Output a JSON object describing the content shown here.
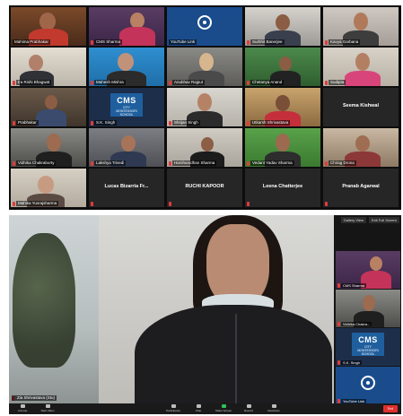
{
  "gallery": {
    "tiles": [
      {
        "name": "Mahima Prabhakar",
        "mic": false
      },
      {
        "name": "CMS Sharma",
        "mic": true
      },
      {
        "name": "YouTube Link",
        "mic": false
      },
      {
        "name": "Surbhit Banerjee",
        "mic": true
      },
      {
        "name": "Kavya Garbana",
        "mic": true
      },
      {
        "name": "Ira Rishi Bhagwat",
        "mic": true
      },
      {
        "name": "Mahesh Mishra",
        "mic": true
      },
      {
        "name": "Anubhav Rajput",
        "mic": true
      },
      {
        "name": "Chetanya Anand",
        "mic": true
      },
      {
        "name": "Sudipta",
        "mic": true
      },
      {
        "name": "Prabhakar",
        "mic": true
      },
      {
        "name": "S.K. Singh",
        "mic": true
      },
      {
        "name": "Shrijan Singh",
        "mic": true
      },
      {
        "name": "Utkarsh Shrivastava",
        "mic": true
      },
      {
        "name": "Seema Kishwal",
        "mic": false
      },
      {
        "name": "Vidhika Chakraborty",
        "mic": true
      },
      {
        "name": "Lakshya Trivedi",
        "mic": true
      },
      {
        "name": "Harshvardhan Sharma",
        "mic": true
      },
      {
        "name": "Vedant Yadav Sharma",
        "mic": true
      },
      {
        "name": "Chirag Drona",
        "mic": true
      },
      {
        "name": "Mahika Yuvrajsharma",
        "mic": true
      },
      {
        "name": "Lucas Bizarria Fr...",
        "mic": true
      },
      {
        "name": "RUCHI KAPOOR",
        "mic": true
      },
      {
        "name": "Leena Chatterjee",
        "mic": true
      },
      {
        "name": "Pranab Agarwal",
        "mic": true
      }
    ]
  },
  "speaker_view": {
    "speaker_name": "Zia Shrivastava (Stu)",
    "buttons": {
      "gallery": "Gallery View",
      "exit_full": "Exit Full Screen"
    },
    "thumbnails": [
      {
        "name": "CMS Sharma"
      },
      {
        "name": "Vidhika Chakra..."
      },
      {
        "name": "S.K. Singh"
      },
      {
        "name": "YouTube Link"
      }
    ],
    "toolbar": {
      "items": [
        "Unmute",
        "Start Video",
        "Participants",
        "Chat",
        "Share Screen",
        "Record",
        "Reactions"
      ],
      "end": "End"
    },
    "logo": {
      "main": "CMS",
      "line1": "CITY",
      "line2": "MONTESSORI",
      "line3": "SCHOOL"
    }
  }
}
